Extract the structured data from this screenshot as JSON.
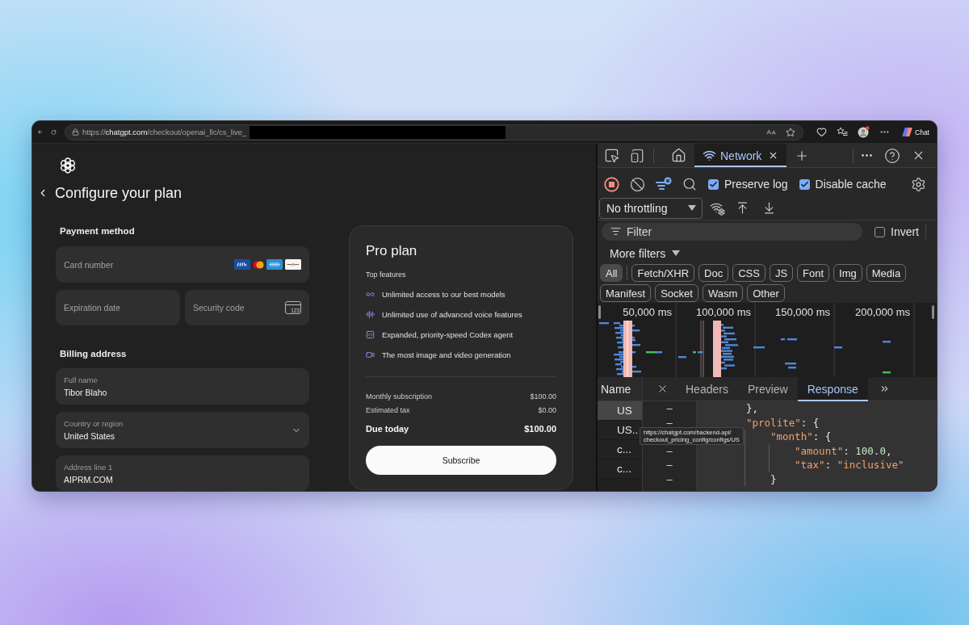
{
  "browser": {
    "url_scheme": "https://",
    "url_host": "chatgpt.com",
    "url_path": "/checkout/openai_llc/cs_live_",
    "url_redacted": true,
    "chat_button": "Chat"
  },
  "checkout": {
    "title": "Configure your plan",
    "payment_method": {
      "heading": "Payment method",
      "card_number": {
        "placeholder": "Card number"
      },
      "expiration_date": {
        "placeholder": "Expiration date"
      },
      "security_code": {
        "placeholder": "Security code",
        "icon_text": "123"
      }
    },
    "billing_address": {
      "heading": "Billing address",
      "fields": [
        {
          "kind": "text",
          "label": "Full name",
          "value": "Tibor Blaho"
        },
        {
          "kind": "select",
          "label": "Country or region",
          "value": "United States"
        },
        {
          "kind": "text",
          "label": "Address line 1",
          "value": "AIPRM.COM"
        }
      ]
    }
  },
  "plan": {
    "title": "Pro plan",
    "features_heading": "Top features",
    "features": [
      {
        "kind": "models",
        "text": "Unlimited access to our best models"
      },
      {
        "kind": "voice",
        "text": "Unlimited use of advanced voice features"
      },
      {
        "kind": "agent",
        "text": "Expanded, priority-speed Codex agent"
      },
      {
        "kind": "media",
        "text": "The most image and video generation"
      }
    ],
    "line_items": [
      {
        "kind": "item",
        "label": "Monthly subscription",
        "amount": "$100.00"
      },
      {
        "kind": "item",
        "label": "Estimated tax",
        "amount": "$0.00"
      },
      {
        "kind": "total",
        "label": "Due today",
        "amount": "$100.00"
      }
    ],
    "subscribe_button": "Subscribe"
  },
  "devtools": {
    "tabs": [
      {
        "kind": "home",
        "selected": false
      },
      {
        "kind": "panel",
        "label": "Network",
        "selected": true
      }
    ],
    "recording": true,
    "preserve_log": {
      "label": "Preserve log",
      "checked": true
    },
    "disable_cache": {
      "label": "Disable cache",
      "checked": true
    },
    "throttling": {
      "value": "No throttling"
    },
    "filter": {
      "placeholder": "Filter"
    },
    "invert": {
      "label": "Invert",
      "checked": false
    },
    "more_filters": "More filters",
    "type_filters": [
      {
        "label": "All",
        "selected": true
      },
      {
        "label": "Fetch/XHR",
        "selected": false
      },
      {
        "label": "Doc",
        "selected": false
      },
      {
        "label": "CSS",
        "selected": false
      },
      {
        "label": "JS",
        "selected": false
      },
      {
        "label": "Font",
        "selected": false
      },
      {
        "label": "Img",
        "selected": false
      },
      {
        "label": "Media",
        "selected": false
      },
      {
        "label": "Manifest",
        "selected": false
      },
      {
        "label": "Socket",
        "selected": false
      },
      {
        "label": "Wasm",
        "selected": false
      },
      {
        "label": "Other",
        "selected": false
      }
    ],
    "overview": {
      "ticks": [
        "50,000 ms",
        "100,000 ms",
        "150,000 ms",
        "200,000 ms"
      ]
    },
    "name_header": "Name",
    "requests": [
      {
        "name": "US",
        "selected": true
      },
      {
        "name": "US..",
        "selected": false
      },
      {
        "name": "c...",
        "selected": false
      },
      {
        "name": "c...",
        "selected": false
      }
    ],
    "detail_tabs": [
      {
        "label": "Headers",
        "selected": false
      },
      {
        "label": "Preview",
        "selected": false
      },
      {
        "label": "Response",
        "selected": true
      }
    ],
    "gutter": [
      "–",
      "–",
      "–",
      "–",
      "–"
    ],
    "response": [
      {
        "tokens": [
          {
            "kind": "punct",
            "text": "},"
          }
        ]
      },
      {
        "tokens": [
          {
            "kind": "key",
            "text": "\"prolite\""
          },
          {
            "kind": "punct",
            "text": ": {"
          }
        ],
        "children": [
          {
            "tokens": [
              {
                "kind": "key",
                "text": "\"month\""
              },
              {
                "kind": "punct",
                "text": ": {"
              }
            ],
            "children": [
              {
                "tokens": [
                  {
                    "kind": "key",
                    "text": "\"amount\""
                  },
                  {
                    "kind": "punct",
                    "text": ": "
                  },
                  {
                    "kind": "number",
                    "text": "100.0"
                  },
                  {
                    "kind": "punct",
                    "text": ","
                  }
                ]
              },
              {
                "tokens": [
                  {
                    "kind": "key",
                    "text": "\"tax\""
                  },
                  {
                    "kind": "punct",
                    "text": ": "
                  },
                  {
                    "kind": "string",
                    "text": "\"inclusive\""
                  }
                ]
              }
            ]
          },
          {
            "tokens": [
              {
                "kind": "punct",
                "text": "}"
              }
            ]
          }
        ]
      }
    ],
    "tooltip": [
      "https://chatgpt.com/backend-api/",
      "checkout_pricing_config/configs/US"
    ]
  }
}
